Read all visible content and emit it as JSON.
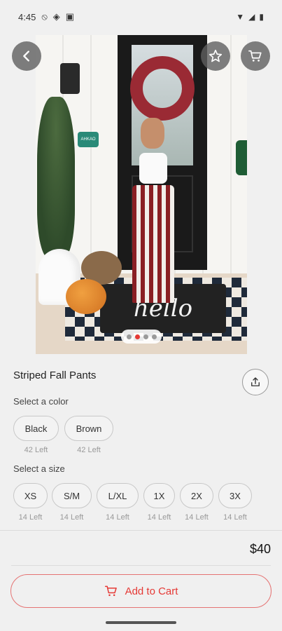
{
  "status_bar": {
    "time": "4:45"
  },
  "product": {
    "title": "Striped Fall Pants",
    "color_label": "Select a color",
    "colors": [
      {
        "name": "Black",
        "stock": "42 Left"
      },
      {
        "name": "Brown",
        "stock": "42 Left"
      }
    ],
    "size_label": "Select a size",
    "sizes": [
      {
        "name": "XS",
        "stock": "14 Left"
      },
      {
        "name": "S/M",
        "stock": "14 Left"
      },
      {
        "name": "L/XL",
        "stock": "14 Left"
      },
      {
        "name": "1X",
        "stock": "14 Left"
      },
      {
        "name": "2X",
        "stock": "14 Left"
      },
      {
        "name": "3X",
        "stock": "14 Left"
      }
    ],
    "price": "$40",
    "add_to_cart": "Add to Cart"
  },
  "image": {
    "mat_text": "hello",
    "sign_text": "AHKAO",
    "dots_total": 4,
    "dots_active": 1
  },
  "icons": {
    "back": "arrow-left-icon",
    "favorite": "star-icon",
    "cart": "cart-icon",
    "share": "share-icon"
  },
  "colors": {
    "accent": "#e53935",
    "accent_border": "#e57373",
    "overlay_button": "#5f5f5f"
  }
}
